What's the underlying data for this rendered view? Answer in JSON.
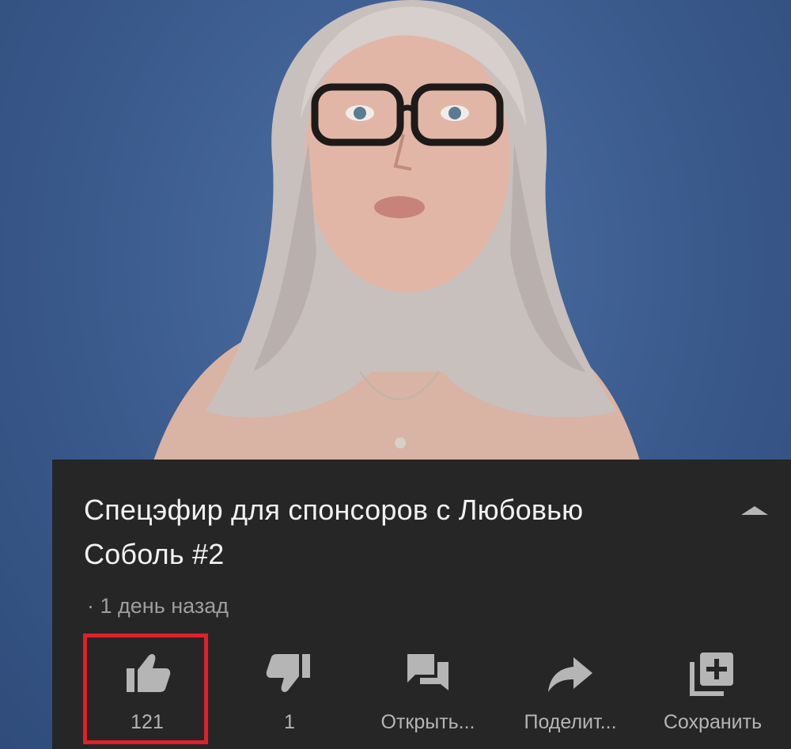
{
  "video": {
    "title_line1": "Спецэфир для спонсоров с Любовью",
    "title_line2": "Соболь #2",
    "meta": "· 1 день назад"
  },
  "actions": {
    "like_count": "121",
    "dislike_count": "1",
    "open_label": "Открыть...",
    "share_label": "Поделит...",
    "save_label": "Сохранить"
  },
  "icons": {
    "like": "thumbs-up-icon",
    "dislike": "thumbs-down-icon",
    "open": "chat-icon",
    "share": "share-arrow-icon",
    "save": "add-to-playlist-icon",
    "collapse": "collapse-triangle-icon"
  },
  "colors": {
    "background": "#3a5a8c",
    "panel": "#262626",
    "title": "#f1f1f1",
    "secondary": "#9e9e9e",
    "icon": "#b5b5b5",
    "highlight": "#e0202a"
  }
}
